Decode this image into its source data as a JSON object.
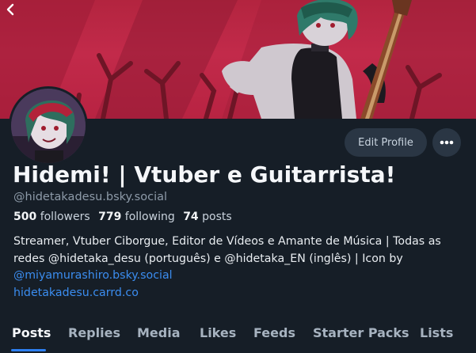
{
  "header": {
    "back_icon": "chevron-left-icon"
  },
  "profile": {
    "display_name": "Hidemi! | Vtuber e Guitarrista!",
    "handle": "@hidetakadesu.bsky.social",
    "edit_label": "Edit Profile",
    "more_icon": "ellipsis-icon",
    "stats": {
      "followers_count": "500",
      "followers_label": "followers",
      "following_count": "779",
      "following_label": "following",
      "posts_count": "74",
      "posts_label": "posts"
    },
    "bio": {
      "line1": "Streamer, Vtuber Ciborgue, Editor de Vídeos e Amante de Música | Todas as",
      "line2": "redes @hidetaka_desu (português) e @hidetaka_EN (inglês) | Icon by",
      "link_mention": "@miyamurashiro.bsky.social",
      "link_site": "hidetakadesu.carrd.co"
    }
  },
  "tabs": [
    {
      "label": "Posts",
      "active": true
    },
    {
      "label": "Replies",
      "active": false
    },
    {
      "label": "Media",
      "active": false
    },
    {
      "label": "Likes",
      "active": false
    },
    {
      "label": "Feeds",
      "active": false
    },
    {
      "label": "Starter Packs",
      "active": false
    },
    {
      "label": "Lists",
      "active": false
    }
  ],
  "colors": {
    "background": "#161e27",
    "banner_red": "#c22a4a",
    "accent_blue": "#2d80f2",
    "link_blue": "#3b8df0",
    "button_bg": "#2a3644"
  }
}
